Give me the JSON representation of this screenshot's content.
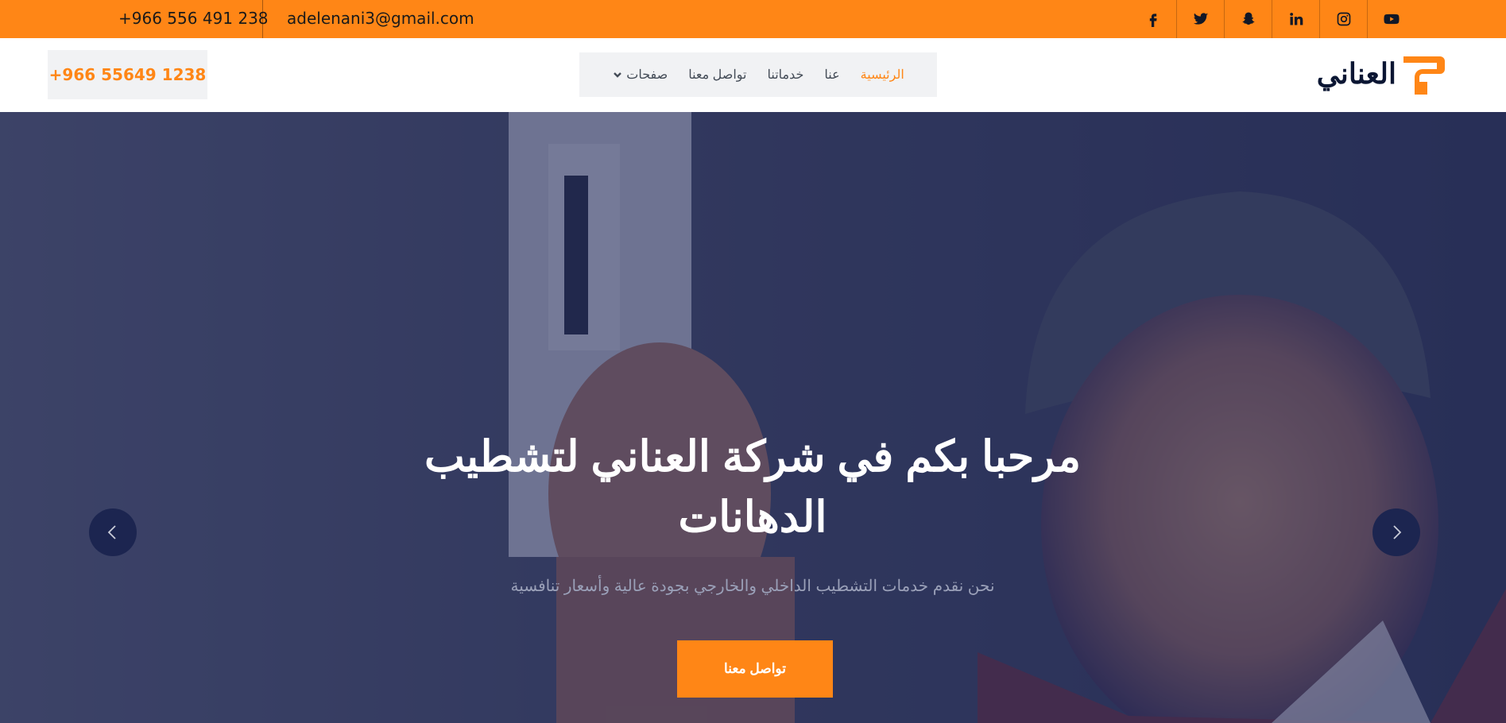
{
  "topbar": {
    "phone": "+966 556 491 238",
    "email": "adelenani3@gmail.com",
    "social": [
      "facebook-icon",
      "twitter-icon",
      "snapchat-icon",
      "linkedin-icon",
      "instagram-icon",
      "youtube-icon"
    ]
  },
  "navbar": {
    "call_number": "+966 55649 1238",
    "logo_text": "العناني",
    "menu": {
      "home": "الرئيسية",
      "about": "عنا",
      "services": "خدماتنا",
      "contact": "تواصل معنا",
      "pages": "صفحات"
    }
  },
  "hero": {
    "title": "مرحبا بكم في شركة العناني لتشطيب الدهانات",
    "subtitle": "نحن نقدم خدمات التشطيب الداخلي والخارجي بجودة عالية وأسعار تنافسية",
    "cta_label": "تواصل معنا"
  },
  "colors": {
    "accent": "#ff8616",
    "navy": "#0b1633",
    "overlay": "#161e50"
  }
}
